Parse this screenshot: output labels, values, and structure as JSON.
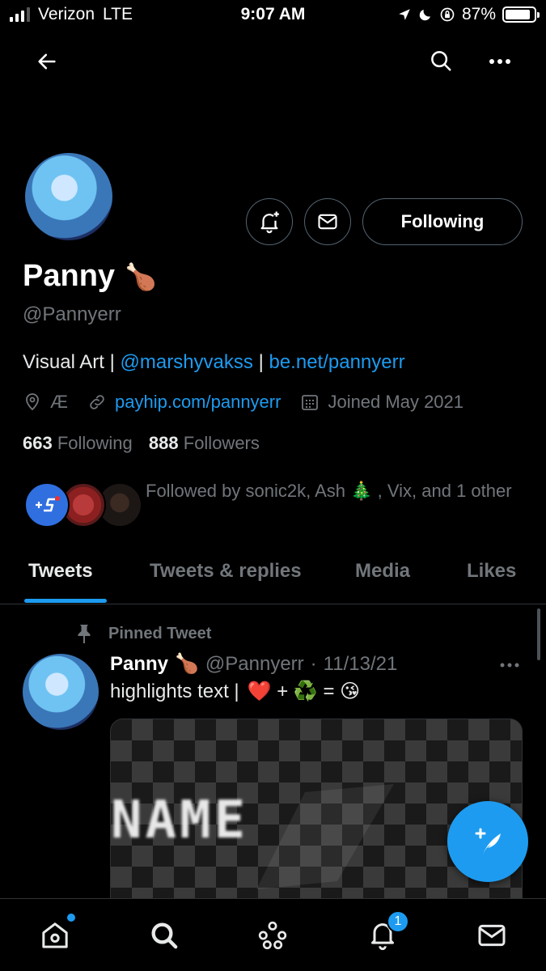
{
  "status_bar": {
    "carrier": "Verizon",
    "network": "LTE",
    "time": "9:07 AM",
    "battery": "87%",
    "battery_level": 0.87
  },
  "profile": {
    "name": "Panny",
    "name_emoji": "🍗",
    "handle": "@Pannyerr",
    "bio_prefix": "Visual Art | ",
    "bio_mention": "@marshyvakss",
    "bio_sep": " | ",
    "bio_link": "be.net/pannyerr",
    "location": "Æ",
    "website": "payhip.com/pannyerr",
    "joined": "Joined May 2021",
    "following_count": "663",
    "following_label": "Following",
    "followers_count": "888",
    "followers_label": "Followers",
    "followed_by": "Followed by sonic2k, Ash 🎄 , Vix, and 1 other",
    "follow_button": "Following"
  },
  "tabs": [
    {
      "label": "Tweets",
      "active": true
    },
    {
      "label": "Tweets & replies",
      "active": false
    },
    {
      "label": "Media",
      "active": false
    },
    {
      "label": "Likes",
      "active": false
    }
  ],
  "pinned_tweet": {
    "pinned_label": "Pinned Tweet",
    "author_name": "Panny",
    "author_emoji": "🍗",
    "author_handle": "@Pannyerr",
    "date": "11/13/21",
    "text": "highlights text  |",
    "emoji_sequence": "❤️ + ♻️ = 😘",
    "media_text": "NAME"
  },
  "bottom_nav": {
    "notification_badge": "1"
  },
  "colors": {
    "accent": "#1d9bf0",
    "background": "#000000",
    "secondary_text": "#71767b"
  }
}
